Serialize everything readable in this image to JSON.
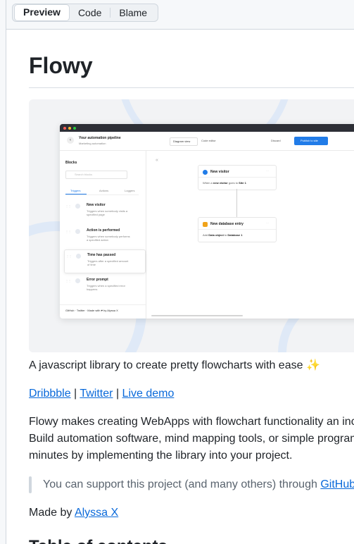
{
  "tabs": [
    {
      "label": "Preview",
      "active": true
    },
    {
      "label": "Code",
      "active": false
    },
    {
      "label": "Blame",
      "active": false
    }
  ],
  "readme": {
    "title": "Flowy",
    "tagline": "A javascript library to create pretty flowcharts with ease ✨",
    "links": [
      "Dribbble",
      "Twitter",
      "Live demo"
    ],
    "link_separator": "|",
    "description_lines": [
      "Flowy makes creating WebApps with flowchart functionality an incr",
      "Build automation software, mind mapping tools, or simple program",
      "minutes by implementing the library into your project."
    ],
    "quote_text": "You can support this project (and many others) through ",
    "quote_link": "GitHub",
    "made_by_prefix": "Made by ",
    "made_by_link": "Alyssa X",
    "next_heading": "Table of contents"
  },
  "hero_mock": {
    "header_title": "Your automation pipeline",
    "header_subtitle": "Marketing automation",
    "view_tabs": [
      "Diagram view",
      "Code editor"
    ],
    "discard_label": "Discard",
    "publish_label": "Publish to site",
    "panel_title": "Blocks",
    "search_placeholder": "Search blocks",
    "panel_tabs": [
      "Triggers",
      "Actions",
      "Loggers"
    ],
    "blocks": [
      {
        "title": "New visitor",
        "desc1": "Triggers when somebody visits a",
        "desc2": "specified page"
      },
      {
        "title": "Action is performed",
        "desc1": "Triggers when somebody performs",
        "desc2": "a specified action"
      },
      {
        "title": "Time has passed",
        "desc1": "Triggers after a specified amount",
        "desc2": "of time"
      },
      {
        "title": "Error prompt",
        "desc1": "Triggers when a specified error",
        "desc2": "happens"
      }
    ],
    "footer_credit": "GitHub · Twitter · Made with ♥ by Alyssa X",
    "canvas_nodes": [
      {
        "title": "New visitor",
        "body_pre": "When a ",
        "body_bold": "new visitor",
        "body_post": " goes to ",
        "body_bold2": "Site 1"
      },
      {
        "title": "New database entry",
        "body_pre": "Add ",
        "body_bold": "Data object",
        "body_post": " to ",
        "body_bold2": "Database 1"
      }
    ],
    "accent_color": "#217ce8"
  }
}
